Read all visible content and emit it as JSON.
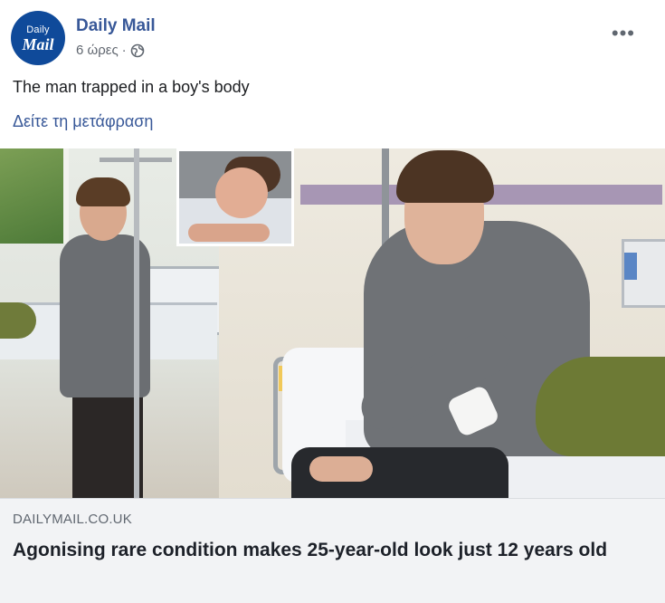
{
  "post": {
    "page_name": "Daily Mail",
    "avatar_line1": "Daily",
    "avatar_line2": "Mail",
    "time": "6 ώρες",
    "separator": "·",
    "privacy_icon": "globe-icon",
    "more_label": "•••",
    "text": "The man trapped in a boy's body",
    "translate_link": "Δείτε τη μετάφραση"
  },
  "link_preview": {
    "domain": "DAILYMAIL.CO.UK",
    "headline": "Agonising rare condition makes 25-year-old look just 12 years old"
  },
  "colors": {
    "page_name": "#385898",
    "avatar_bg": "#0f4a9a",
    "caption_bg": "#f2f3f5",
    "secondary_text": "#616770"
  }
}
